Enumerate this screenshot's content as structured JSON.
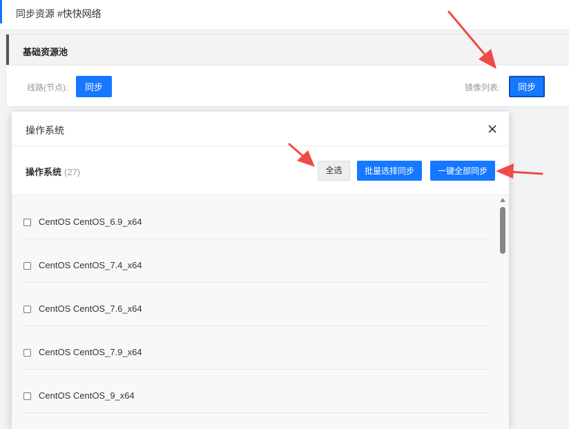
{
  "page": {
    "title": "同步资源 #快快网络"
  },
  "panel": {
    "title": "基础资源池",
    "route_label": "线路(节点):",
    "route_sync_button": "同步",
    "mirror_label": "镜像列表:",
    "mirror_sync_button": "同步"
  },
  "modal": {
    "title": "操作系统",
    "section_title": "操作系统",
    "count": "(27)",
    "select_all": "全选",
    "batch_sync": "批量选择同步",
    "sync_all": "一键全部同步",
    "items": [
      "CentOS CentOS_6.9_x64",
      "CentOS CentOS_7.4_x64",
      "CentOS CentOS_7.6_x64",
      "CentOS CentOS_7.9_x64",
      "CentOS CentOS_9_x64"
    ]
  },
  "colors": {
    "primary": "#1677ff",
    "annotation_arrow": "#f04a45"
  },
  "icons": {
    "close": "close-icon",
    "annotation": "red-arrow-icon"
  }
}
